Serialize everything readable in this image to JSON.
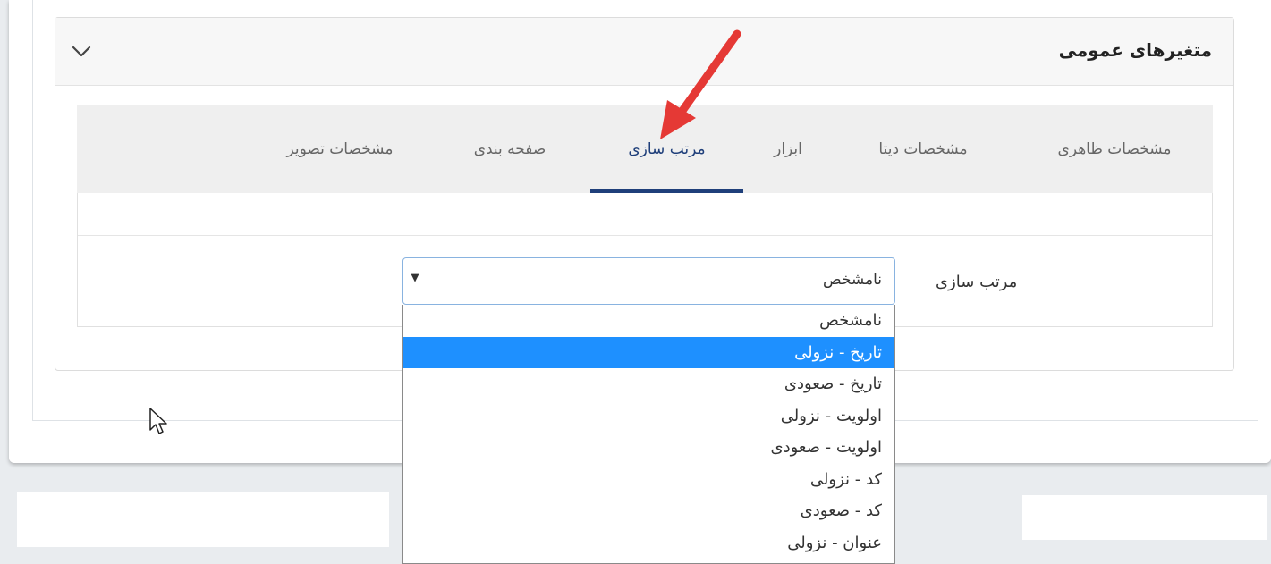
{
  "panel": {
    "title": "متغیرهای عمومی",
    "collapse_icon": "chevron-down-icon"
  },
  "tabs": [
    {
      "label": "مشخصات ظاهری",
      "active": false
    },
    {
      "label": "مشخصات دیتا",
      "active": false
    },
    {
      "label": "ابزار",
      "active": false
    },
    {
      "label": "مرتب سازی",
      "active": true
    },
    {
      "label": "صفحه بندی",
      "active": false
    },
    {
      "label": "مشخصات تصویر",
      "active": false
    }
  ],
  "sort_field": {
    "label": "مرتب سازی",
    "selected": "نامشخص",
    "options": [
      "نامشخص",
      "تاریخ - نزولی",
      "تاریخ - صعودی",
      "اولویت - نزولی",
      "اولویت - صعودی",
      "کد - نزولی",
      "کد - صعودی",
      "عنوان - نزولی"
    ],
    "highlighted_option": "تاریخ - نزولی"
  },
  "colors": {
    "accent": "#1f3f7a",
    "highlight": "#1e90ff",
    "annotation_arrow": "#e53935"
  }
}
